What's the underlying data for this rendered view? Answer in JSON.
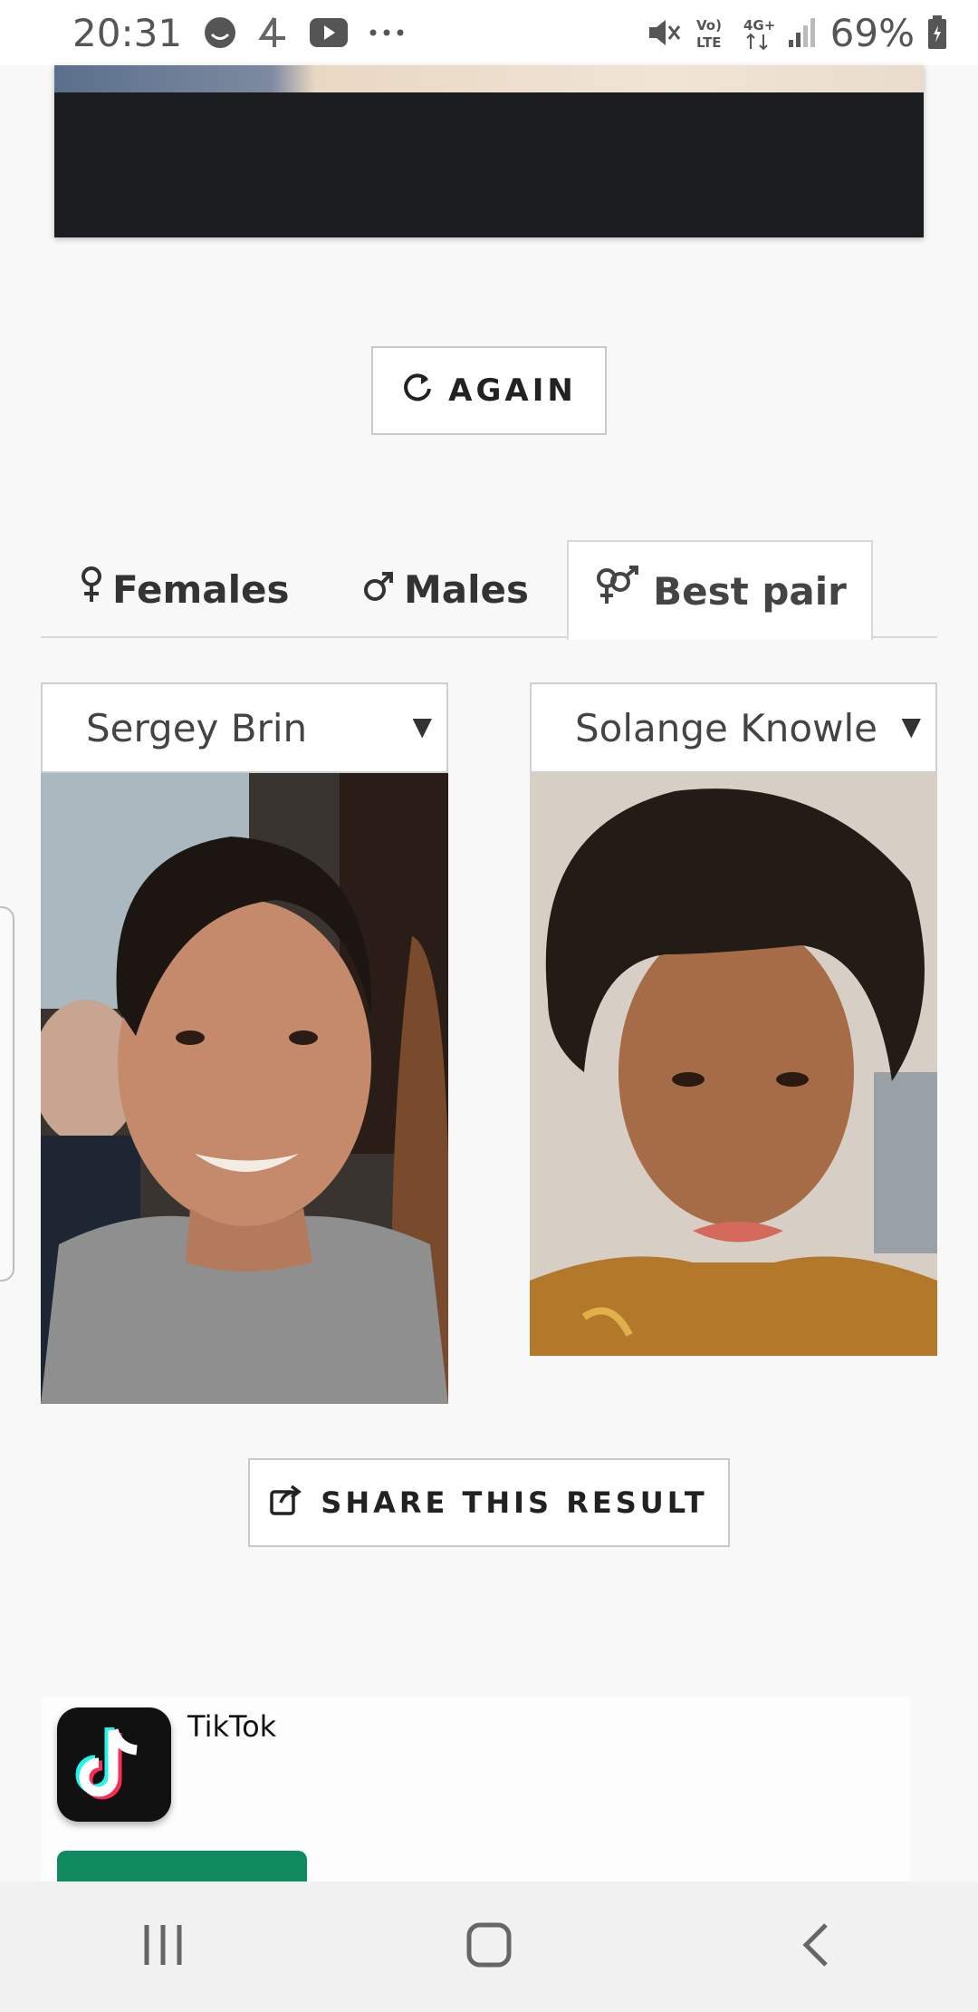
{
  "status_bar": {
    "time": "20:31",
    "battery": "69%",
    "icons_left": [
      "notification-face-icon",
      "channel4-icon",
      "youtube-icon",
      "more-dots-icon"
    ],
    "icons_right": [
      "mute-icon",
      "volte-icon",
      "4g-icon",
      "signal-icon",
      "battery-icon"
    ]
  },
  "buttons": {
    "again_label": "AGAIN",
    "share_label": "SHARE THIS RESULT"
  },
  "tabs": [
    {
      "label": "Females",
      "icon": "female-symbol-icon",
      "active": false
    },
    {
      "label": "Males",
      "icon": "male-symbol-icon",
      "active": false
    },
    {
      "label": "Best pair",
      "icon": "gender-pair-icon",
      "active": true
    }
  ],
  "pair": {
    "left": {
      "selected": "Sergey Brin"
    },
    "right": {
      "selected": "Solange Knowle"
    }
  },
  "ad": {
    "app_name": "TikTok",
    "cta_color": "#0f8a5f"
  },
  "nav": [
    "recent-apps-icon",
    "home-icon",
    "back-icon"
  ]
}
